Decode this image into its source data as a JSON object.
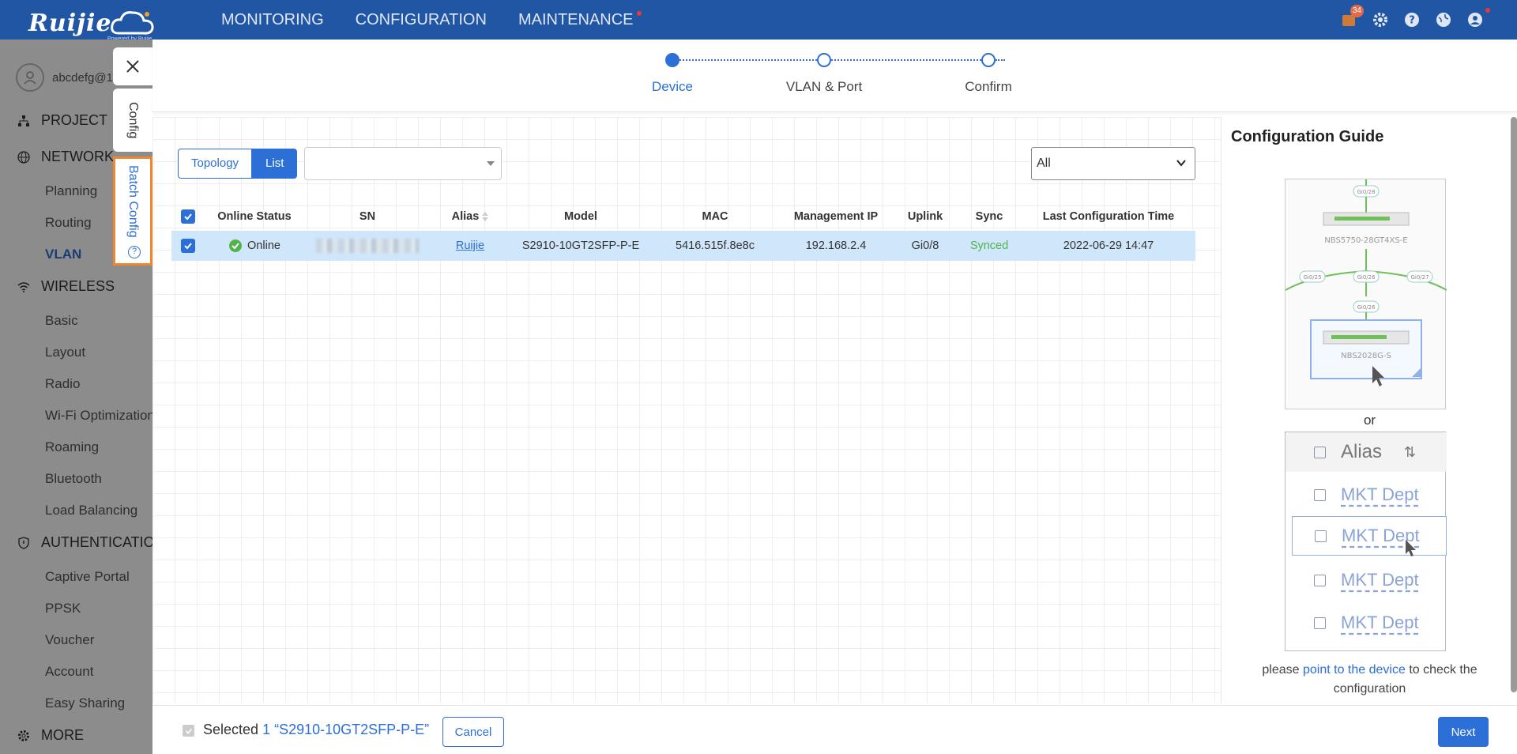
{
  "brand": {
    "logo_text": "Ruijie",
    "logo_sub": "Powered by Ruijie"
  },
  "nav": {
    "items": [
      {
        "label": "MONITORING"
      },
      {
        "label": "CONFIGURATION"
      },
      {
        "label": "MAINTENANCE",
        "dot": true
      }
    ],
    "notification_count": "34"
  },
  "sidebar": {
    "user": "abcdefg@1",
    "sections": [
      {
        "label": "PROJECT",
        "icon": "sitemap-icon"
      },
      {
        "label": "NETWORK",
        "icon": "globe-icon",
        "subs": [
          "Planning",
          "Routing",
          "VLAN"
        ]
      },
      {
        "label": "WIRELESS",
        "icon": "wifi-icon",
        "subs": [
          "Basic",
          "Layout",
          "Radio",
          "Wi-Fi Optimization",
          "Roaming",
          "Bluetooth",
          "Load Balancing"
        ]
      },
      {
        "label": "AUTHENTICATION",
        "icon": "shield-icon",
        "subs": [
          "Captive Portal",
          "PPSK",
          "Voucher",
          "Account",
          "Easy Sharing"
        ]
      },
      {
        "label": "MORE",
        "icon": "gear-icon"
      }
    ],
    "active": "VLAN"
  },
  "side_tabs": {
    "config": "Config",
    "batch_config": "Batch Config"
  },
  "steps": [
    {
      "label": "Device",
      "active": true
    },
    {
      "label": "VLAN & Port",
      "active": false
    },
    {
      "label": "Confirm",
      "active": false
    }
  ],
  "toolbar": {
    "topology_label": "Topology",
    "list_label": "List",
    "dropdown_value": "",
    "filter_value": "All"
  },
  "table": {
    "headers": [
      "Online Status",
      "SN",
      "Alias",
      "Model",
      "MAC",
      "Management IP",
      "Uplink",
      "Sync",
      "Last Configuration Time"
    ],
    "rows": [
      {
        "online_status": "Online",
        "sn": "",
        "alias": "Ruijie",
        "model": "S2910-10GT2SFP-P-E",
        "mac": "5416.515f.8e8c",
        "management_ip": "192.168.2.4",
        "uplink": "Gi0/8",
        "sync": "Synced",
        "last_config_time": "2022-06-29 14:47"
      }
    ]
  },
  "guide": {
    "title": "Configuration Guide",
    "topology_labels": [
      "Gi0/28",
      "NBS5750-28GT4XS-E",
      "Gi0/25",
      "Gi0/26",
      "Gi0/27",
      "Gi0/26",
      "NBS2028G-S"
    ],
    "or": "or",
    "list_header": "Alias",
    "list_items": [
      "MKT Dept",
      "MKT Dept",
      "MKT Dept",
      "MKT Dept"
    ],
    "note_prefix": "please ",
    "note_link": "point to the device",
    "note_suffix": " to check the configuration"
  },
  "footer": {
    "selected_label": "Selected",
    "selected_count": "1",
    "selected_item": "“S2910-10GT2SFP-P-E”",
    "cancel_label": "Cancel",
    "next_label": "Next"
  },
  "colors": {
    "primary": "#2c6fd6",
    "header": "#2156a5",
    "highlight": "#f0872f",
    "success": "#52b34a"
  }
}
